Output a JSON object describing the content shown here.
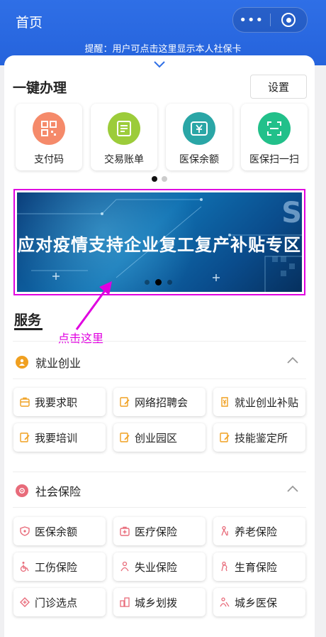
{
  "header": {
    "title": "首页",
    "reminder": "提醒：用户可点击这里显示本人社保卡"
  },
  "onekey": {
    "title": "一键办理",
    "settings_label": "设置",
    "items": [
      {
        "label": "支付码",
        "icon": "qr-code-icon",
        "color": "#f58a6a"
      },
      {
        "label": "交易账单",
        "icon": "bill-list-icon",
        "color": "#9ccc3a"
      },
      {
        "label": "医保余额",
        "icon": "yuan-card-icon",
        "color": "#2aa6a6"
      },
      {
        "label": "医保扫一扫",
        "icon": "scan-icon",
        "color": "#22c08a"
      }
    ]
  },
  "banner": {
    "text": "应对疫情支持企业复工复产补贴专区",
    "decor_letter": "S"
  },
  "annotation": {
    "text": "点击这里",
    "color": "#e000e0"
  },
  "services": {
    "title": "服务",
    "categories": [
      {
        "label": "就业创业",
        "icon": "employment-icon",
        "icon_color": "#f0a020",
        "items": [
          "我要求职",
          "网络招聘会",
          "就业创业补贴",
          "我要培训",
          "创业园区",
          "技能鉴定所"
        ]
      },
      {
        "label": "社会保险",
        "icon": "insurance-icon",
        "icon_color": "#e86b7a",
        "items": [
          "医保余额",
          "医疗保险",
          "养老保险",
          "工伤保险",
          "失业保险",
          "生育保险",
          "门诊选点",
          "城乡划拨",
          "城乡医保"
        ]
      }
    ]
  }
}
